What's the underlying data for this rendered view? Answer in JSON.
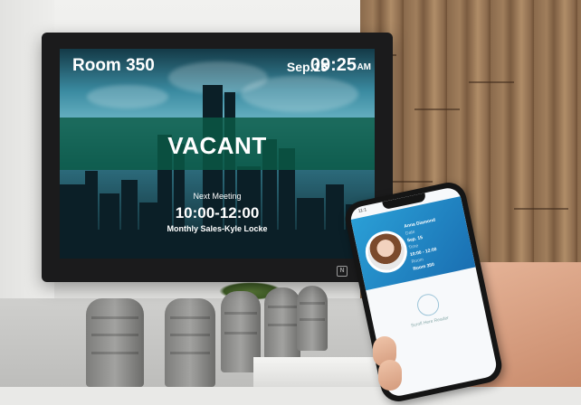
{
  "display": {
    "room_name": "Room 350",
    "date": "Sep.15",
    "time": "09:25",
    "ampm": "AM",
    "status": "VACANT",
    "next_meeting": {
      "label": "Next Meeting",
      "time_range": "10:00-12:00",
      "title": "Monthly Sales-Kyle Locke"
    },
    "nfc_icon": "nfc-icon"
  },
  "phone": {
    "status_time": "11:1",
    "user_name": "Anna Diamond",
    "fields": [
      {
        "label": "Date",
        "value": "Sep. 15"
      },
      {
        "label": "Time",
        "value": "10:00 - 12:00"
      },
      {
        "label": "Room",
        "value": "Room 350"
      }
    ],
    "hint": "Scroll Here Reader"
  },
  "colors": {
    "vacant_band": "#0a5a46",
    "bezel": "#1b1b1c",
    "phone_card": "#2a9fd6"
  }
}
